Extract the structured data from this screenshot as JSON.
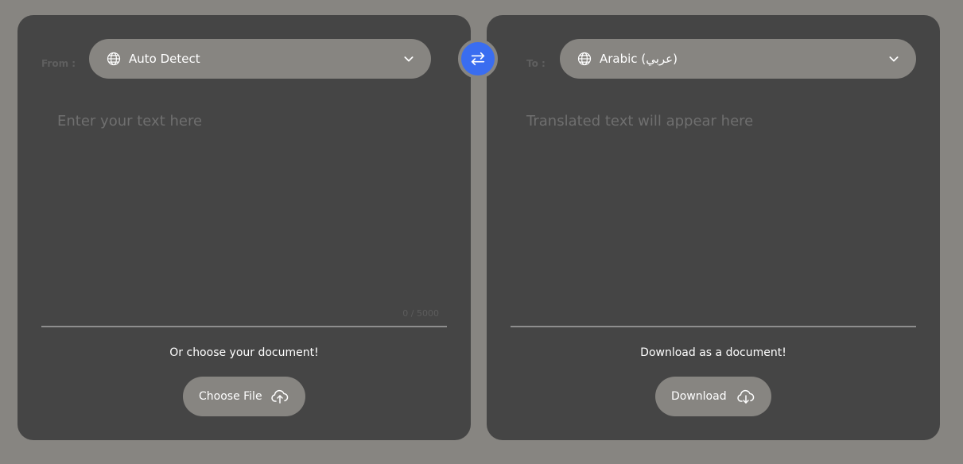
{
  "source": {
    "label": "From :",
    "language": "Auto Detect",
    "input_placeholder": "Enter your text here",
    "char_count": "0 / 5000",
    "doc_caption": "Or choose your document!",
    "file_button_label": "Choose File"
  },
  "target": {
    "label": "To :",
    "language": "Arabic (عربي)",
    "output_placeholder": "Translated text will appear here",
    "doc_caption": "Download as a document!",
    "download_button_label": "Download"
  },
  "icons": {
    "globe": "globe-icon",
    "chevron": "chevron-down-icon",
    "swap": "swap-arrows-icon",
    "upload": "cloud-upload-icon",
    "download": "cloud-download-icon"
  },
  "colors": {
    "background": "#878581",
    "panel": "#454545",
    "accent": "#3a6df0"
  }
}
